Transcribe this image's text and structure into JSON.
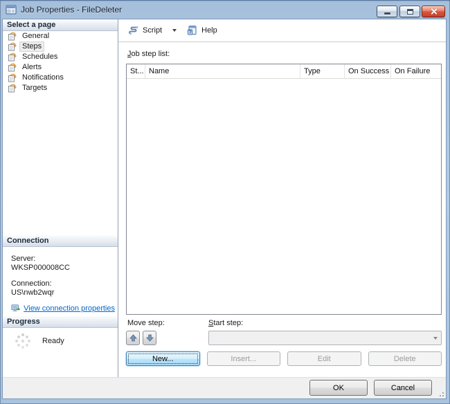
{
  "window": {
    "title": "Job Properties - FileDeleter",
    "colors": {
      "titlebar_top": "#a6c0dc",
      "titlebar_bottom": "#b4cbe4",
      "close_button_red": "#d4563c",
      "link_blue": "#0066cc",
      "focus_button_blue": "#3c7fb1",
      "footer_gray": "#f0f0f0"
    }
  },
  "toolbar": {
    "script": "Script",
    "help": "Help"
  },
  "sidebar": {
    "select_page_header": "Select a page",
    "pages": [
      {
        "label": "General",
        "selected": false
      },
      {
        "label": "Steps",
        "selected": true
      },
      {
        "label": "Schedules",
        "selected": false
      },
      {
        "label": "Alerts",
        "selected": false
      },
      {
        "label": "Notifications",
        "selected": false
      },
      {
        "label": "Targets",
        "selected": false
      }
    ],
    "connection": {
      "header": "Connection",
      "server_label": "Server:",
      "server_value": "WKSP000008CC",
      "connection_label": "Connection:",
      "connection_value": "US\\nwb2wqr",
      "link": "View connection properties"
    },
    "progress": {
      "header": "Progress",
      "status": "Ready"
    }
  },
  "main": {
    "job_step_list_label": "Job step list:",
    "table": {
      "columns": [
        "St...",
        "Name",
        "Type",
        "On Success",
        "On Failure"
      ],
      "rows": []
    },
    "move_step_label": "Move step:",
    "start_step_label": "Start step:",
    "start_step_value": "",
    "buttons": {
      "new": "New...",
      "insert": "Insert...",
      "edit": "Edit",
      "delete": "Delete"
    }
  },
  "footer": {
    "ok": "OK",
    "cancel": "Cancel"
  }
}
